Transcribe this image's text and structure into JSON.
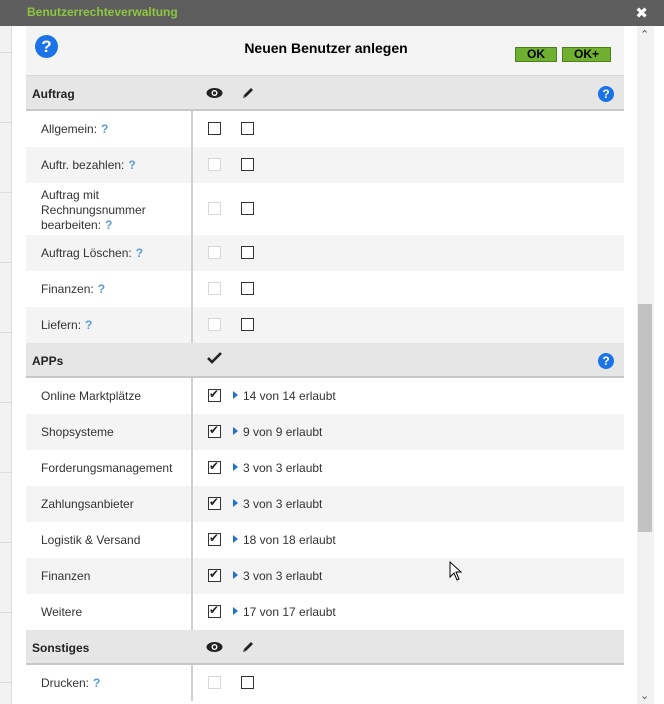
{
  "window": {
    "title": "Benutzerrechteverwaltung",
    "close": "✖"
  },
  "dialog": {
    "title": "Neuen Benutzer anlegen",
    "help": "?",
    "ok_label": "OK",
    "okplus_label": "OK+"
  },
  "sections": {
    "auftrag": {
      "title": "Auftrag",
      "help": "?",
      "rows": [
        {
          "label": "Allgemein:",
          "q": "?"
        },
        {
          "label": "Auftr. bezahlen:",
          "q": "?"
        },
        {
          "label_lines": [
            "Auftrag mit",
            "Rechnungsnummer"
          ],
          "label_last": "bearbeiten:",
          "q": "?"
        },
        {
          "label": "Auftrag Löschen:",
          "q": "?"
        },
        {
          "label": "Finanzen:",
          "q": "?"
        },
        {
          "label": "Liefern:",
          "q": "?"
        }
      ]
    },
    "apps": {
      "title": "APPs",
      "help": "?",
      "rows": [
        {
          "label": "Online Marktplätze",
          "text": "14 von 14 erlaubt"
        },
        {
          "label": "Shopsysteme",
          "text": "9 von 9 erlaubt"
        },
        {
          "label": "Forderungsmanagement",
          "text": "3 von 3 erlaubt"
        },
        {
          "label": "Zahlungsanbieter",
          "text": "3 von 3 erlaubt"
        },
        {
          "label": "Logistik & Versand",
          "text": "18 von 18 erlaubt"
        },
        {
          "label": "Finanzen",
          "text": "3 von 3 erlaubt"
        },
        {
          "label": "Weitere",
          "text": "17 von 17 erlaubt"
        }
      ]
    },
    "sonstiges": {
      "title": "Sonstiges",
      "rows": [
        {
          "label": "Drucken:",
          "q": "?"
        }
      ]
    }
  },
  "icons": {
    "view": "eye-icon",
    "edit": "pencil-icon",
    "check": "checkmark-icon"
  },
  "colors": {
    "titlebar": "#5e5e5e",
    "title_text": "#8dc63f",
    "ok_button": "#70b030",
    "help": "#1a73e8"
  }
}
